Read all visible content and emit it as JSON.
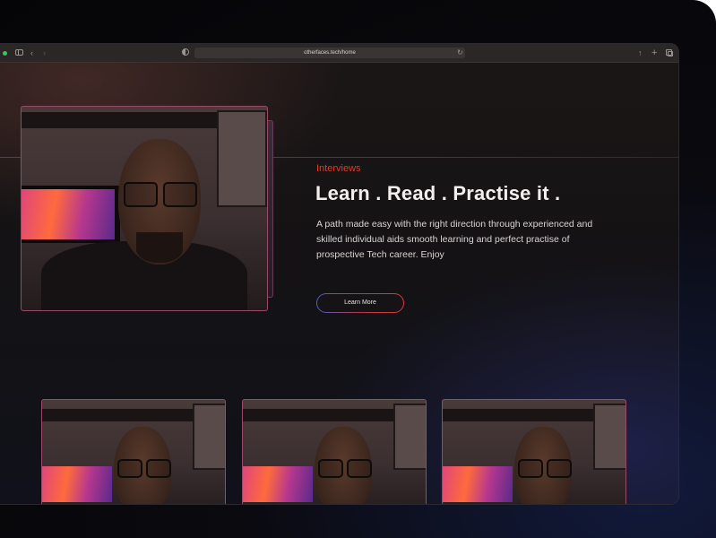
{
  "browser": {
    "url": "otherfaces.tech/home"
  },
  "hero": {
    "eyebrow": "Interviews",
    "headline": "Learn . Read . Practise it .",
    "description": "A path made easy with the right direction through experienced and skilled individual aids smooth learning and perfect practise of prospective Tech career. Enjoy",
    "cta_label": "Learn More"
  },
  "colors": {
    "accent_red": "#e23a2a",
    "accent_blue": "#4860c8",
    "background": "#141214"
  }
}
